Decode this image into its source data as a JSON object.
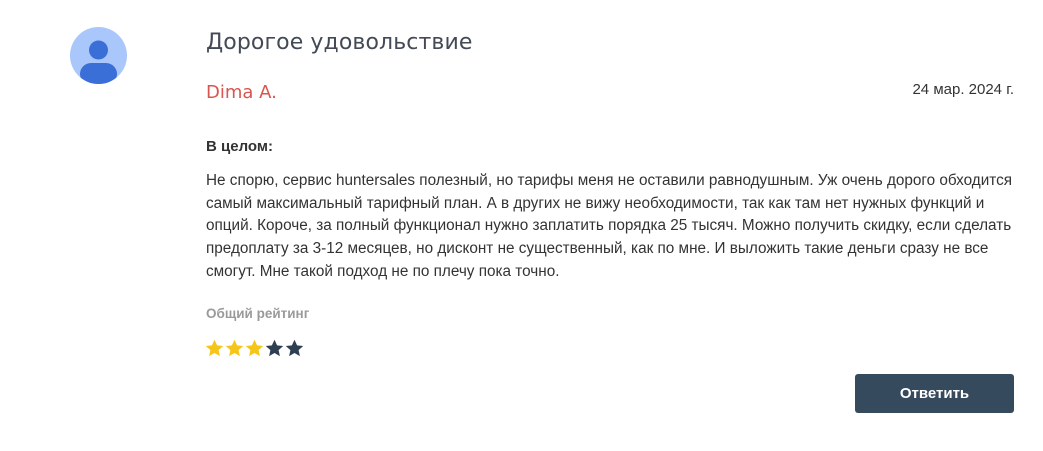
{
  "review": {
    "title": "Дорогое удовольствие",
    "author": "Dima A.",
    "date": "24 мар. 2024 г.",
    "section_label": "В целом:",
    "text": "Не спорю, сервис huntersales полезный, но тарифы меня не оставили равнодушным. Уж очень дорого обходится самый максимальный тарифный план. А в других не вижу необходимости, так как там нет нужных функций и опций. Короче, за полный функционал нужно заплатить порядка 25 тысяч. Можно получить скидку, если сделать предоплату за 3-12 месяцев, но дисконт не существенный, как по мне. И выложить такие деньги сразу не все смогут. Мне такой подход не по плечу пока точно.",
    "rating_label": "Общий рейтинг",
    "rating": 3,
    "rating_max": 5
  },
  "actions": {
    "reply_label": "Ответить"
  },
  "colors": {
    "avatar_bg": "#a9c7fb",
    "avatar_fg": "#3b6fd8",
    "author": "#d9554f",
    "star_filled": "#f5c518",
    "star_empty": "#2e3f52",
    "button_bg": "#364a5e"
  },
  "icons": {
    "avatar": "user-silhouette-icon",
    "star": "star-icon"
  }
}
